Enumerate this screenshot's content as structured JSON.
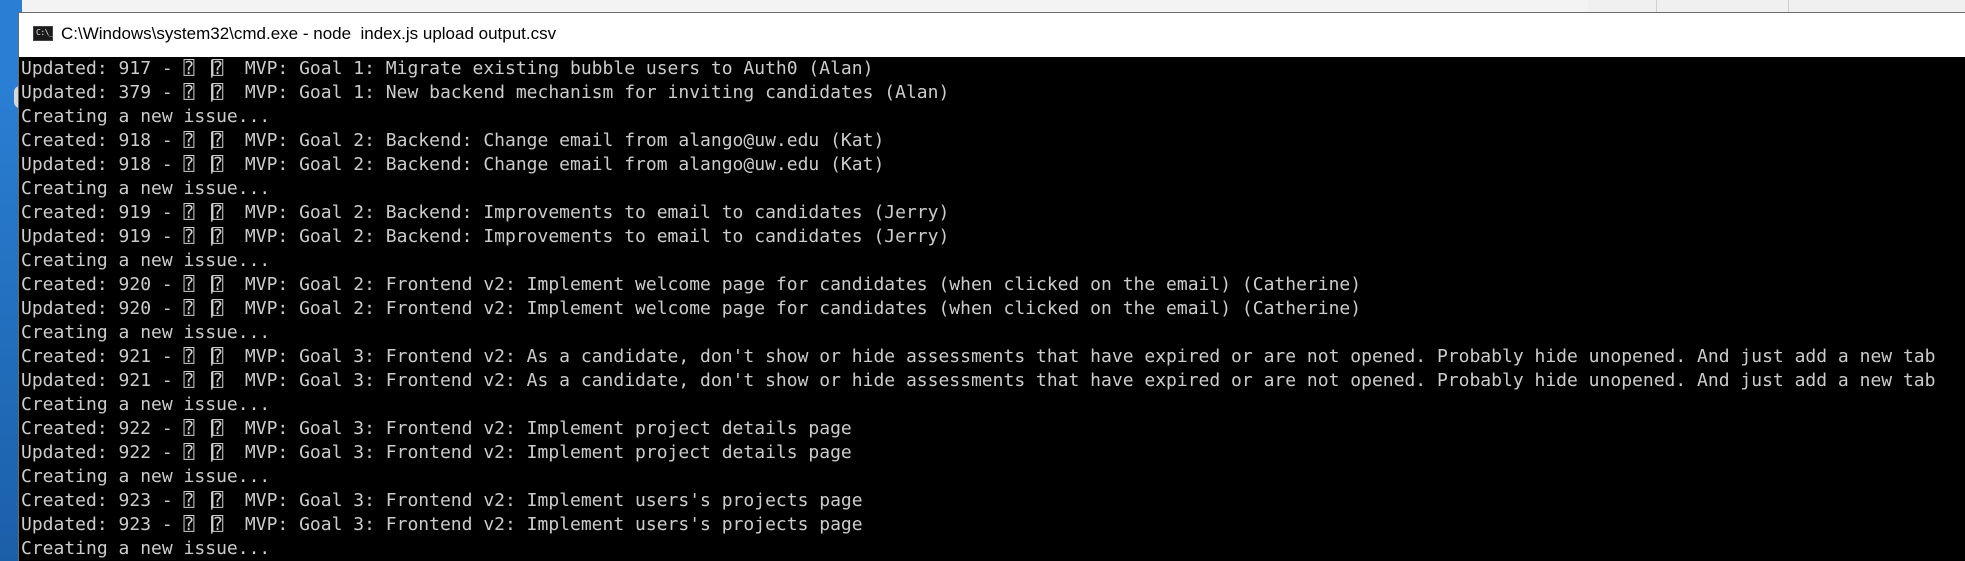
{
  "window": {
    "title": "C:\\Windows\\system32\\cmd.exe - node  index.js upload output.csv",
    "icon": "cmd-icon",
    "icon_text": "C:\\_"
  },
  "background_window": {
    "glyph_1": "⌃",
    "glyph_2": "⌃"
  },
  "console": {
    "lines": [
      "Updated: 917 - ⍰⎹⍰  MVP: Goal 1: Migrate existing bubble users to Auth0 (Alan)",
      "Updated: 379 - ⍰⎹⍰  MVP: Goal 1: New backend mechanism for inviting candidates (Alan)",
      "Creating a new issue...",
      "Created: 918 - ⍰⎹⍰  MVP: Goal 2: Backend: Change email from alango@uw.edu (Kat)",
      "Updated: 918 - ⍰⎹⍰  MVP: Goal 2: Backend: Change email from alango@uw.edu (Kat)",
      "Creating a new issue...",
      "Created: 919 - ⍰⎹⍰  MVP: Goal 2: Backend: Improvements to email to candidates (Jerry)",
      "Updated: 919 - ⍰⎹⍰  MVP: Goal 2: Backend: Improvements to email to candidates (Jerry)",
      "Creating a new issue...",
      "Created: 920 - ⍰⎹⍰  MVP: Goal 2: Frontend v2: Implement welcome page for candidates (when clicked on the email) (Catherine)",
      "Updated: 920 - ⍰⎹⍰  MVP: Goal 2: Frontend v2: Implement welcome page for candidates (when clicked on the email) (Catherine)",
      "Creating a new issue...",
      "Created: 921 - ⍰⎹⍰  MVP: Goal 3: Frontend v2: As a candidate, don't show or hide assessments that have expired or are not opened. Probably hide unopened. And just add a new tab",
      "Updated: 921 - ⍰⎹⍰  MVP: Goal 3: Frontend v2: As a candidate, don't show or hide assessments that have expired or are not opened. Probably hide unopened. And just add a new tab",
      "Creating a new issue...",
      "Created: 922 - ⍰⎹⍰  MVP: Goal 3: Frontend v2: Implement project details page",
      "Updated: 922 - ⍰⎹⍰  MVP: Goal 3: Frontend v2: Implement project details page",
      "Creating a new issue...",
      "Created: 923 - ⍰⎹⍰  MVP: Goal 3: Frontend v2: Implement users's projects page",
      "Updated: 923 - ⍰⎹⍰  MVP: Goal 3: Frontend v2: Implement users's projects page",
      "Creating a new issue..."
    ]
  },
  "colors": {
    "console_background": "#000000",
    "console_text": "#cccccc",
    "titlebar_background": "#ffffff",
    "desktop_accent": "#2a7fd4"
  }
}
